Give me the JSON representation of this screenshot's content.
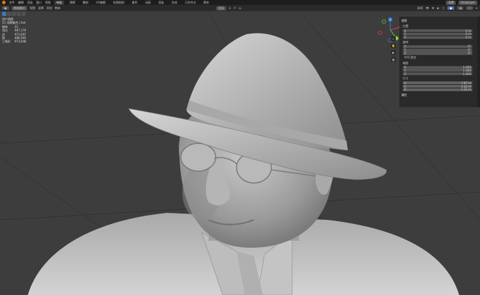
{
  "topbar": {
    "menus": [
      "文件",
      "编辑",
      "渲染",
      "窗口",
      "帮助"
    ],
    "workspaces": [
      "布局",
      "建模",
      "雕刻",
      "UV编辑",
      "纹理绘制",
      "着色",
      "动画",
      "渲染",
      "合成",
      "几何节点",
      "脚本"
    ],
    "active_workspace": "布局",
    "right": [
      "场景",
      "ViewLayer"
    ]
  },
  "header2": {
    "mode": "物体模式",
    "menus": [
      "视图",
      "选择",
      "添加",
      "物体"
    ],
    "transform": "全局",
    "right_labels": [
      "选项"
    ]
  },
  "stats": {
    "title": "用户透视",
    "collection": "(1) 场景集合 | hat",
    "rows": [
      {
        "k": "物体",
        "v": "22"
      },
      {
        "k": "顶点",
        "v": "487,174"
      },
      {
        "k": "边",
        "v": "973,597"
      },
      {
        "k": "面",
        "v": "486,565"
      },
      {
        "k": "三角形",
        "v": "973,048"
      }
    ]
  },
  "npanel": {
    "header": "变换",
    "location": {
      "label": "位置",
      "x": "0 m",
      "y": "0 m",
      "z": "0 m"
    },
    "rotation": {
      "label": "旋转",
      "x": "0°",
      "y": "0°",
      "z": "0°"
    },
    "rotation_mode": "XYZ 欧拉",
    "scale": {
      "label": "缩放",
      "x": "1.000",
      "y": "1.000",
      "z": "1.000"
    },
    "dimensions": {
      "label": "尺寸",
      "x": "1.87 m",
      "y": "1.15 m",
      "z": "1.31 m"
    },
    "properties": "属性"
  },
  "gizmo": {
    "x": "X",
    "y": "Y",
    "z": "Z"
  },
  "colors": {
    "x_axis": "#e8384f",
    "y_axis": "#6ec92a",
    "z_axis": "#2f83e0",
    "accent": "#4772b3"
  }
}
